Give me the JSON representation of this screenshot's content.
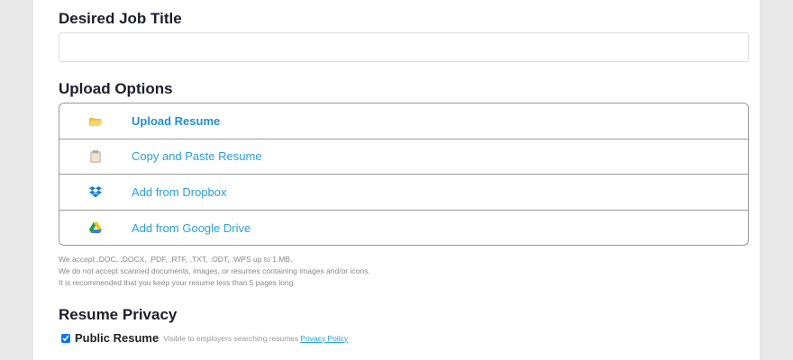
{
  "job_title": {
    "heading": "Desired Job Title",
    "value": ""
  },
  "upload": {
    "heading": "Upload Options",
    "options": [
      {
        "label": "Upload Resume",
        "icon": "folder-icon"
      },
      {
        "label": "Copy and Paste Resume",
        "icon": "clipboard-icon"
      },
      {
        "label": "Add from Dropbox",
        "icon": "dropbox-icon"
      },
      {
        "label": "Add from Google Drive",
        "icon": "google-drive-icon"
      }
    ],
    "notes": [
      "We accept .DOC, .DOCX, .PDF, .RTF, .TXT, .ODT, .WPS up to 1 MB.",
      "We do not accept scanned documents, images, or resumes containing images and/or icons.",
      "It is recommended that you keep your resume less than 5 pages long."
    ]
  },
  "privacy": {
    "heading": "Resume Privacy",
    "public_label": "Public Resume",
    "public_checked": true,
    "hint": "Visible to employers searching resumes",
    "policy_link": "Privacy Policy"
  }
}
